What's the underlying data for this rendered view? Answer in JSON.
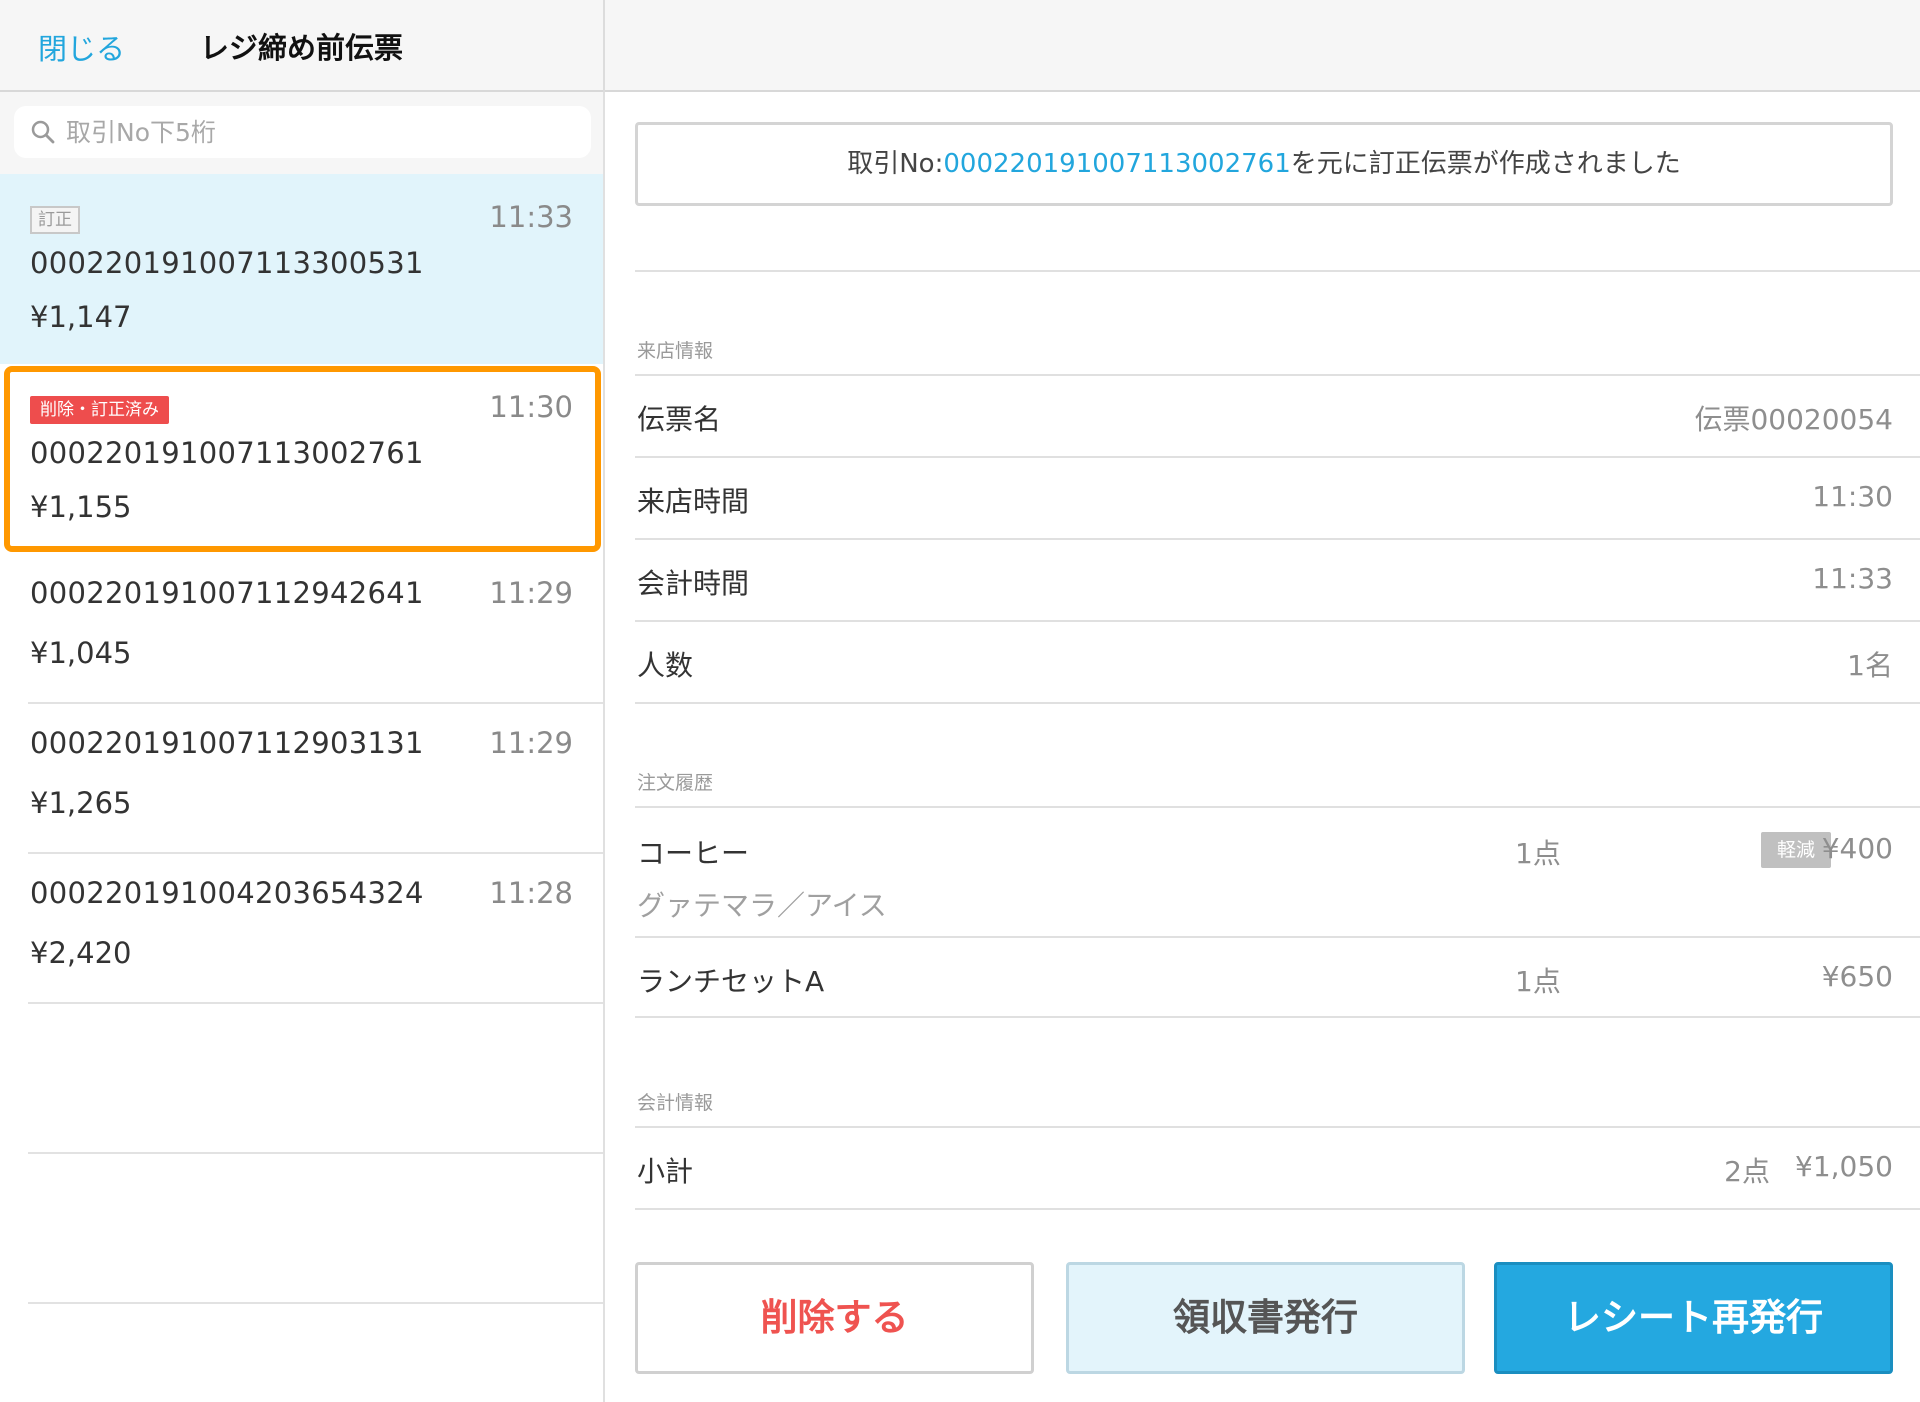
{
  "header": {
    "close_label": "閉じる",
    "title": "レジ締め前伝票"
  },
  "search": {
    "placeholder": "取引No下5桁"
  },
  "transactions": [
    {
      "badge": "訂正",
      "number": "00022019100711330053​1",
      "time": "11:33",
      "amount": "¥1,147"
    },
    {
      "badge": "削除・訂正済み",
      "number": "000220191007113002761",
      "time": "11:30",
      "amount": "¥1,155"
    },
    {
      "number": "000220191007112942641",
      "time": "11:29",
      "amount": "¥1,045"
    },
    {
      "number": "000220191007112903131",
      "time": "11:29",
      "amount": "¥1,265"
    },
    {
      "number": "000220191004203654324",
      "time": "11:28",
      "amount": "¥2,420"
    }
  ],
  "notice": {
    "prefix": "取引No:",
    "number": "000220191007113002761",
    "suffix": "を元に訂正伝票が作成されました"
  },
  "visit_info": {
    "section_label": "来店情報",
    "rows": [
      {
        "label": "伝票名",
        "value": "伝票00020054"
      },
      {
        "label": "来店時間",
        "value": "11:30"
      },
      {
        "label": "会計時間",
        "value": "11:33"
      },
      {
        "label": "人数",
        "value": "1名"
      }
    ]
  },
  "order_history": {
    "section_label": "注文履歴",
    "items": [
      {
        "name": "コーヒー",
        "option": "グァテマラ／アイス",
        "qty": "1点",
        "tax_badge": "軽減",
        "price": "¥400"
      },
      {
        "name": "ランチセットA",
        "qty": "1点",
        "price": "¥650"
      }
    ]
  },
  "payment_info": {
    "section_label": "会計情報",
    "subtotal_label": "小計",
    "subtotal_qty": "2点",
    "subtotal_amount": "¥1,050"
  },
  "buttons": {
    "delete": "削除する",
    "receipt": "領収書発行",
    "reissue": "レシート再発行"
  },
  "colors": {
    "accent": "#22a6dd",
    "highlight": "#ff9800",
    "danger": "#ef5350",
    "selected_bg": "#e1f4fb"
  }
}
